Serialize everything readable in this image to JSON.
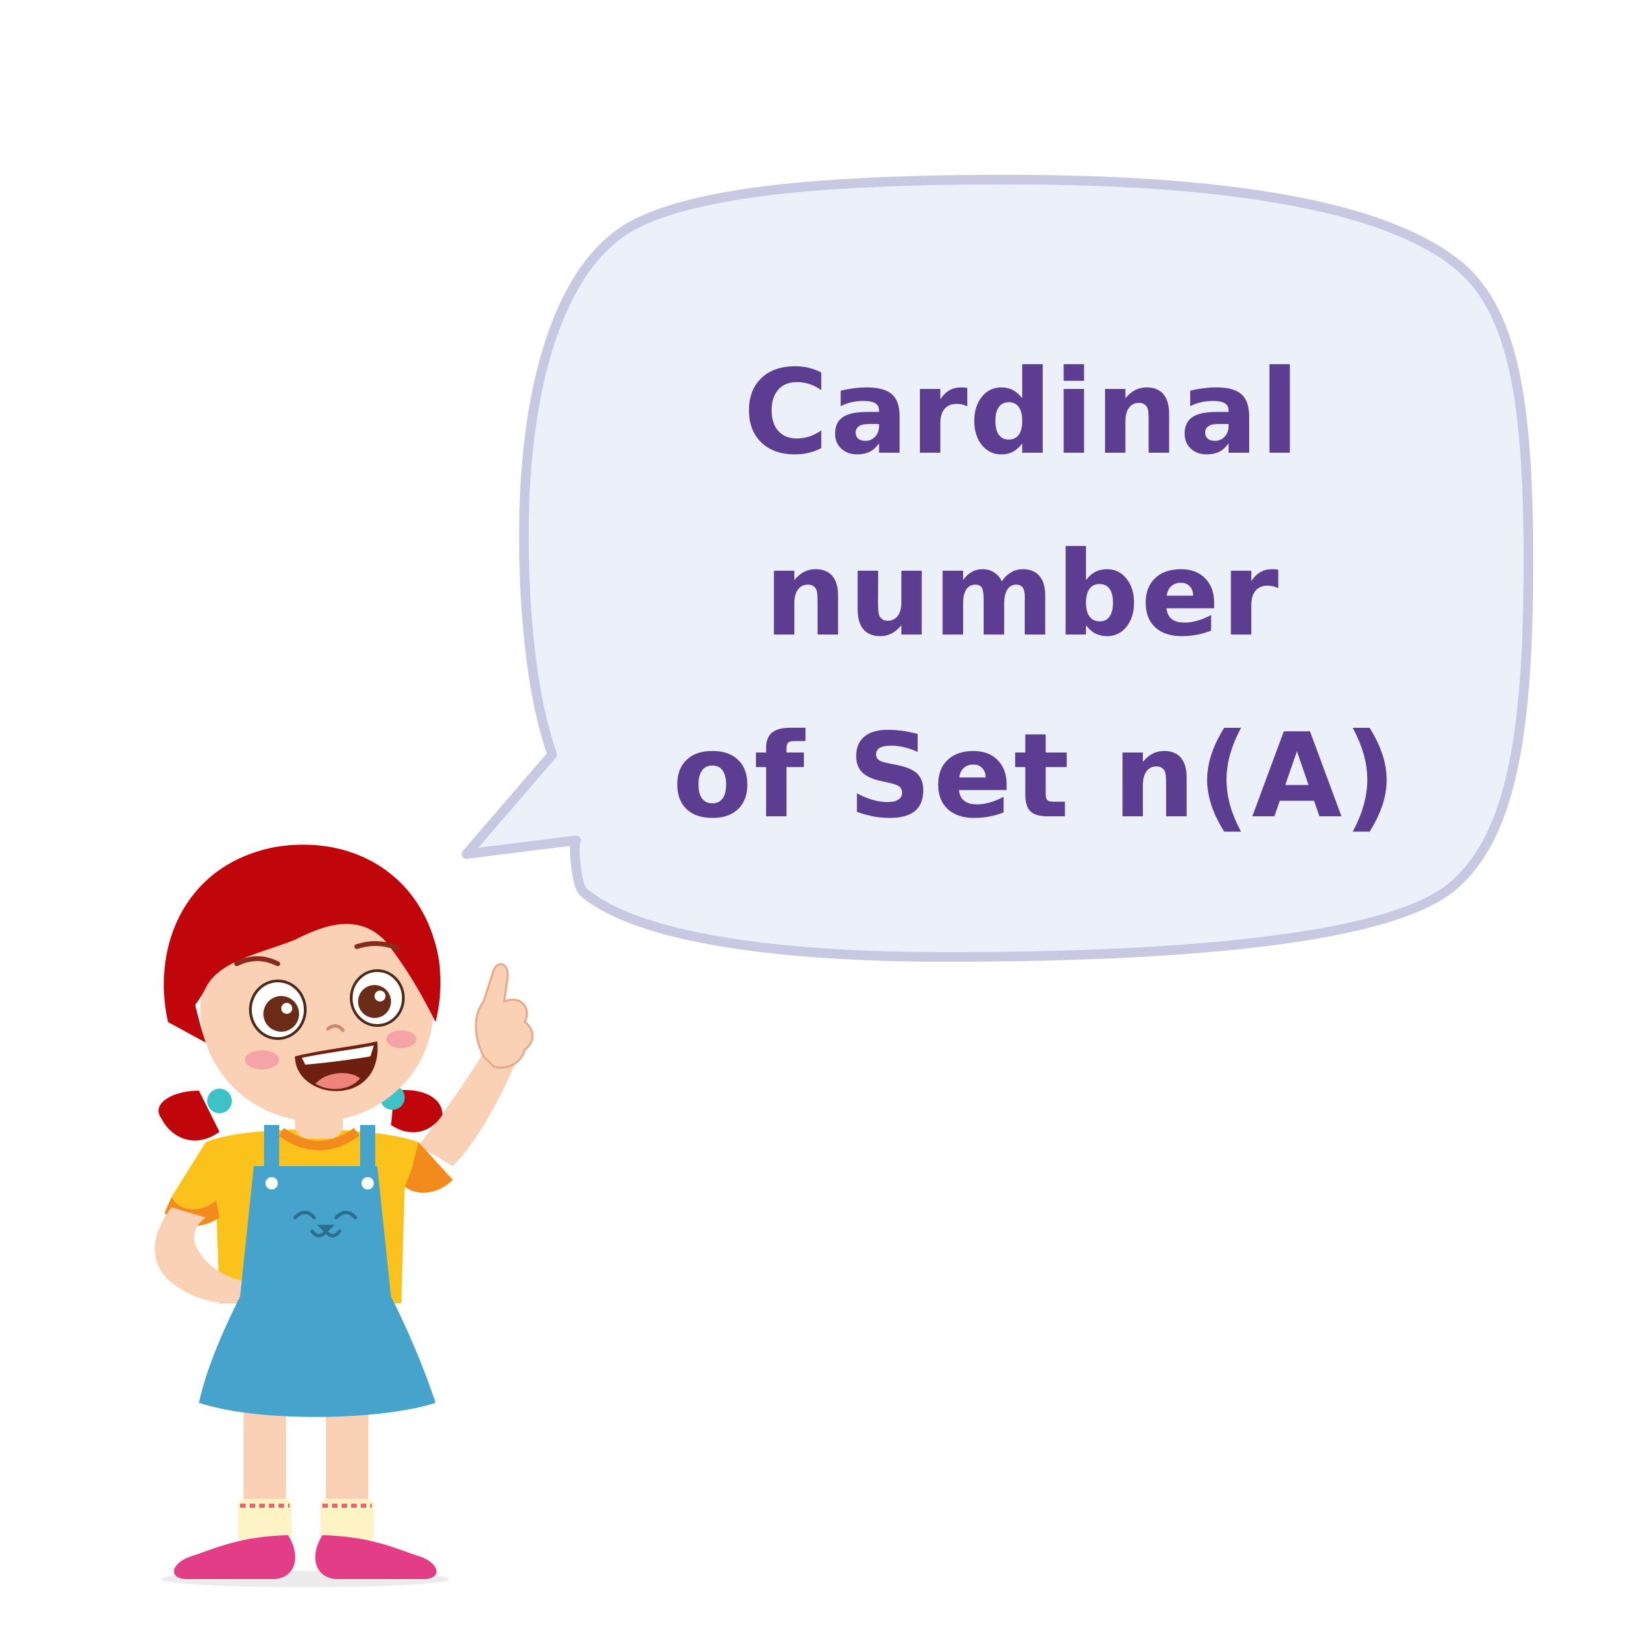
{
  "speech_bubble": {
    "lines": [
      "Cardinal",
      "number",
      "of Set n(A)"
    ]
  },
  "colors": {
    "text": "#5d3d92",
    "bubble_fill": "#ebf0f9",
    "bubble_stroke": "#c8c8e3",
    "hair": "#c0060b",
    "skin": "#fbd1b6",
    "shirt": "#fbc21c",
    "sleeve_trim": "#f38a1c",
    "overall": "#46a3cc",
    "shoe": "#e43d87",
    "sock": "#fdf3c4"
  },
  "illustration": {
    "character": "girl-pointing-up",
    "icon": "cat-face-icon"
  }
}
